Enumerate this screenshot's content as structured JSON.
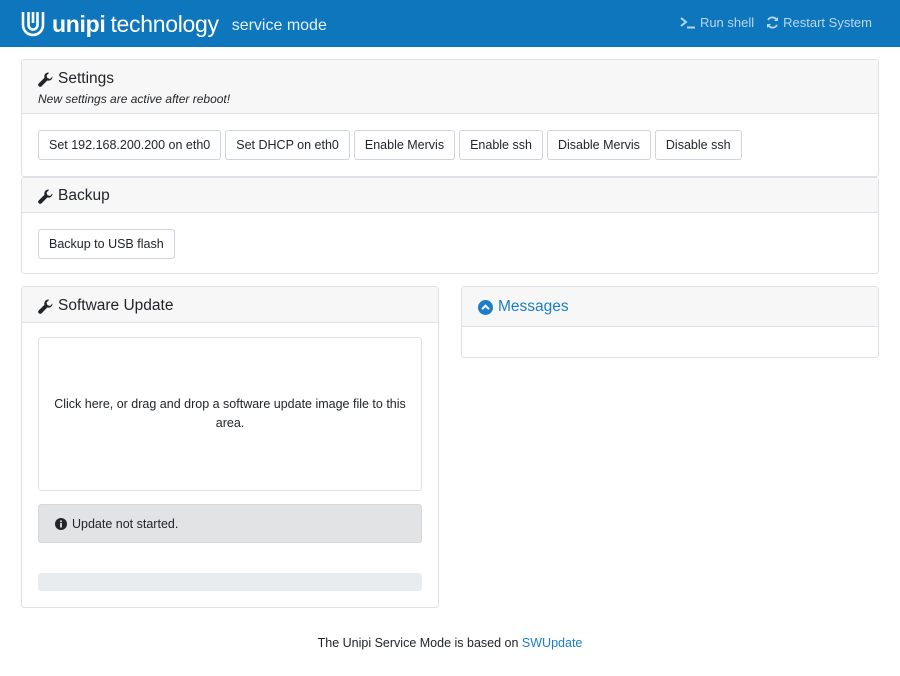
{
  "navbar": {
    "brand_bold": "unipi",
    "brand_light": "technology",
    "mode": "service mode",
    "run_shell": "Run shell",
    "restart": "Restart System"
  },
  "settings": {
    "title": "Settings",
    "subtitle": "New settings are active after reboot!",
    "buttons": [
      "Set 192.168.200.200 on eth0",
      "Set DHCP on eth0",
      "Enable Mervis",
      "Enable ssh",
      "Disable Mervis",
      "Disable ssh"
    ]
  },
  "backup": {
    "title": "Backup",
    "button": "Backup to USB flash"
  },
  "update": {
    "title": "Software Update",
    "dropzone": "Click here, or drag and drop a software update image file to this area.",
    "status": "Update not started.",
    "progress": 0
  },
  "messages": {
    "title": "Messages"
  },
  "footer": {
    "text": "The Unipi Service Mode is based on",
    "link": "SWUpdate"
  },
  "colors": {
    "navbar": "#0e76bc",
    "link": "#1a7fc8"
  },
  "icons": [
    "unipi-logo-icon",
    "terminal-icon",
    "refresh-icon",
    "wrench-icon",
    "info-circle-icon",
    "chevron-up-circle-icon"
  ]
}
